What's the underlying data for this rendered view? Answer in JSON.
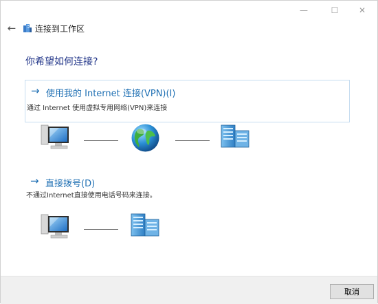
{
  "window": {
    "title": "连接到工作区",
    "controls": {
      "minimize": "—",
      "maximize": "☐",
      "close": "✕"
    },
    "back_icon": "←"
  },
  "page": {
    "heading": "你希望如何连接?"
  },
  "options": [
    {
      "arrow": "→",
      "title": "使用我的 Internet 连接(VPN)(I)",
      "description": "通过 Internet 使用虚拟专用网络(VPN)来连接",
      "icons": [
        "computer-icon",
        "globe-icon",
        "server-icon"
      ]
    },
    {
      "arrow": "→",
      "title": "直接拨号(D)",
      "description": "不通过Internet直接使用电话号码来连接。",
      "icons": [
        "computer-icon",
        "server-icon"
      ]
    }
  ],
  "footer": {
    "cancel_label": "取消"
  },
  "colors": {
    "heading": "#1e3287",
    "link": "#1e6fb3",
    "selected_border": "#c5dcef",
    "footer_bg": "#f0f0f0"
  }
}
